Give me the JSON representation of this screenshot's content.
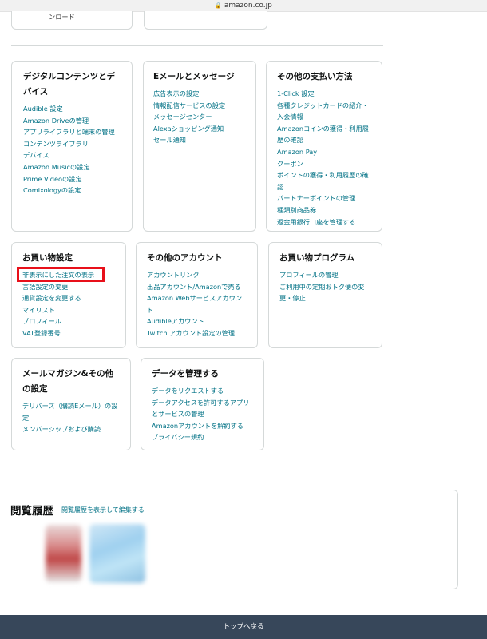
{
  "browser": {
    "domain": "amazon.co.jp"
  },
  "top_cards": [
    {
      "text": "ンロード"
    },
    {
      "text": ""
    }
  ],
  "cards": [
    {
      "title": "デジタルコンテンツとデバイス",
      "links": [
        "Audible 設定",
        "Amazon Driveの管理",
        "アプリライブラリと端末の管理",
        "コンテンツライブラリ",
        "デバイス",
        "Amazon Musicの設定",
        "Prime Videoの設定",
        "Comixologyの設定"
      ]
    },
    {
      "title": "Eメールとメッセージ",
      "links": [
        "広告表示の設定",
        "情報配信サービスの設定",
        "メッセージセンター",
        "Alexaショッピング通知",
        "セール通知"
      ]
    },
    {
      "title": "その他の支払い方法",
      "links": [
        "1-Click 設定",
        "各種クレジットカードの紹介・入会情報",
        "Amazonコインの獲得・利用履歴の確認",
        "Amazon Pay",
        "クーポン",
        "ポイントの獲得・利用履歴の確認",
        "パートナーポイントの管理",
        "種類別商品券",
        "返金用銀行口座を管理する"
      ]
    },
    {
      "title": "お買い物設定",
      "links": [
        "非表示にした注文の表示",
        "言語設定の変更",
        "通貨設定を変更する",
        "マイリスト",
        "プロフィール",
        "VAT登録番号"
      ]
    },
    {
      "title": "その他のアカウント",
      "links": [
        "アカウントリンク",
        "出品アカウント/Amazonで売る",
        "Amazon Webサービスアカウント",
        "Audibleアカウント",
        "Twitch アカウント設定の管理"
      ]
    },
    {
      "title": "お買い物プログラム",
      "links": [
        "プロフィールの管理",
        "ご利用中の定期おトク便の変更・停止"
      ]
    },
    {
      "title": "メールマガジン&その他の設定",
      "links": [
        "デリバーズ（購読Eメール）の設定",
        "メンバーシップおよび購読"
      ]
    },
    {
      "title": "データを管理する",
      "links": [
        "データをリクエストする",
        "データアクセスを許可するアプリとサービスの管理",
        "Amazonアカウントを解約する",
        "プライバシー規約"
      ]
    }
  ],
  "history": {
    "title": "閲覧履歴",
    "edit_link": "閲覧履歴を表示して編集する"
  },
  "footer": {
    "back_to_top": "トップへ戻る"
  },
  "colors": {
    "link": "#007185",
    "highlight": "#e8101a",
    "footer_bg": "#37475a"
  }
}
